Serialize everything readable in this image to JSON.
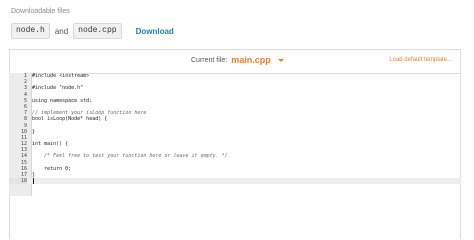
{
  "downloadable": {
    "label": "Downloadable files",
    "files": [
      "node.h",
      "node.cpp"
    ],
    "joiner": "and",
    "download_label": "Download"
  },
  "editor": {
    "current_file_label": "Current file:",
    "current_file_name": "main.cpp",
    "load_template_label": "Load default template...",
    "colors": {
      "accent": "#ef7d22",
      "download": "#1f7fb5"
    },
    "lines": [
      {
        "num": "1",
        "text": "#include <iostream>",
        "comment": false
      },
      {
        "num": "2",
        "text": "",
        "comment": false
      },
      {
        "num": "3",
        "text": "#include \"node.h\"",
        "comment": false
      },
      {
        "num": "4",
        "text": "",
        "comment": false
      },
      {
        "num": "5",
        "text": "using namespace std;",
        "comment": false
      },
      {
        "num": "6",
        "text": "",
        "comment": false
      },
      {
        "num": "7",
        "text": "// implement your isLoop function here",
        "comment": true
      },
      {
        "num": "8",
        "text": "bool isLoop(Node* head) {",
        "comment": false
      },
      {
        "num": "9",
        "text": "",
        "comment": false
      },
      {
        "num": "10",
        "text": "}",
        "comment": false
      },
      {
        "num": "11",
        "text": "",
        "comment": false
      },
      {
        "num": "12",
        "text": "int main() {",
        "comment": false
      },
      {
        "num": "13",
        "text": "",
        "comment": false
      },
      {
        "num": "14",
        "text": "    /* Feel free to test your function here or leave it empty. */",
        "comment": true
      },
      {
        "num": "15",
        "text": "",
        "comment": false
      },
      {
        "num": "16",
        "text": "    return 0;",
        "comment": false
      },
      {
        "num": "17",
        "text": "}",
        "comment": false
      },
      {
        "num": "18",
        "text": "",
        "comment": false
      }
    ],
    "active_line": "18"
  }
}
